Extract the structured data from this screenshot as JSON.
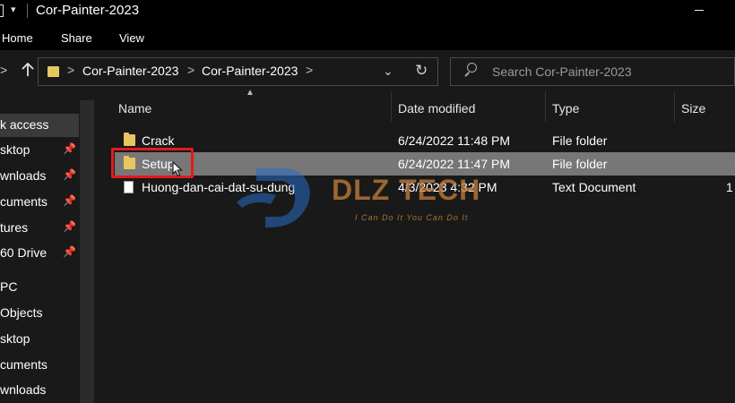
{
  "window": {
    "title": "Cor-Painter-2023",
    "quick_access_arrow": "▾"
  },
  "ribbon": {
    "tabs": [
      "Home",
      "Share",
      "View"
    ]
  },
  "address": {
    "back_chevron": ">",
    "crumbs": [
      "Cor-Painter-2023",
      "Cor-Painter-2023"
    ],
    "separator": ">",
    "dropdown": "⌄",
    "refresh": "↻"
  },
  "search": {
    "placeholder": "Search Cor-Painter-2023"
  },
  "nav_pane": {
    "items": [
      {
        "label": "k access",
        "pinned": false
      },
      {
        "label": "sktop",
        "pinned": true
      },
      {
        "label": "wnloads",
        "pinned": true
      },
      {
        "label": "cuments",
        "pinned": true
      },
      {
        "label": "tures",
        "pinned": true
      },
      {
        "label": "60 Drive",
        "pinned": true
      },
      {
        "label": "PC",
        "pinned": false
      },
      {
        "label": "Objects",
        "pinned": false
      },
      {
        "label": "sktop",
        "pinned": false
      },
      {
        "label": "cuments",
        "pinned": false
      },
      {
        "label": "wnloads",
        "pinned": false
      }
    ],
    "pin_glyph": "📌"
  },
  "columns": {
    "name": "Name",
    "date_modified": "Date modified",
    "type": "Type",
    "size": "Size"
  },
  "files": [
    {
      "name": "Crack",
      "date": "6/24/2022 11:48 PM",
      "type": "File folder",
      "size": "",
      "icon": "folder-icon",
      "selected": false
    },
    {
      "name": "Setup",
      "date": "6/24/2022 11:47 PM",
      "type": "File folder",
      "size": "",
      "icon": "folder-icon",
      "selected": true
    },
    {
      "name": "Huong-dan-cai-dat-su-dung",
      "date": "4/3/2023 4:32 PM",
      "type": "Text Document",
      "size": "1",
      "icon": "text-document-icon",
      "selected": false
    }
  ],
  "watermark": {
    "brand": "DLZ TECH",
    "tagline": "I Can Do It You Can Do It",
    "color": "#c6803c"
  },
  "colors": {
    "selection": "#777777",
    "highlight_box": "#e21b1b",
    "folder": "#e7c561"
  }
}
